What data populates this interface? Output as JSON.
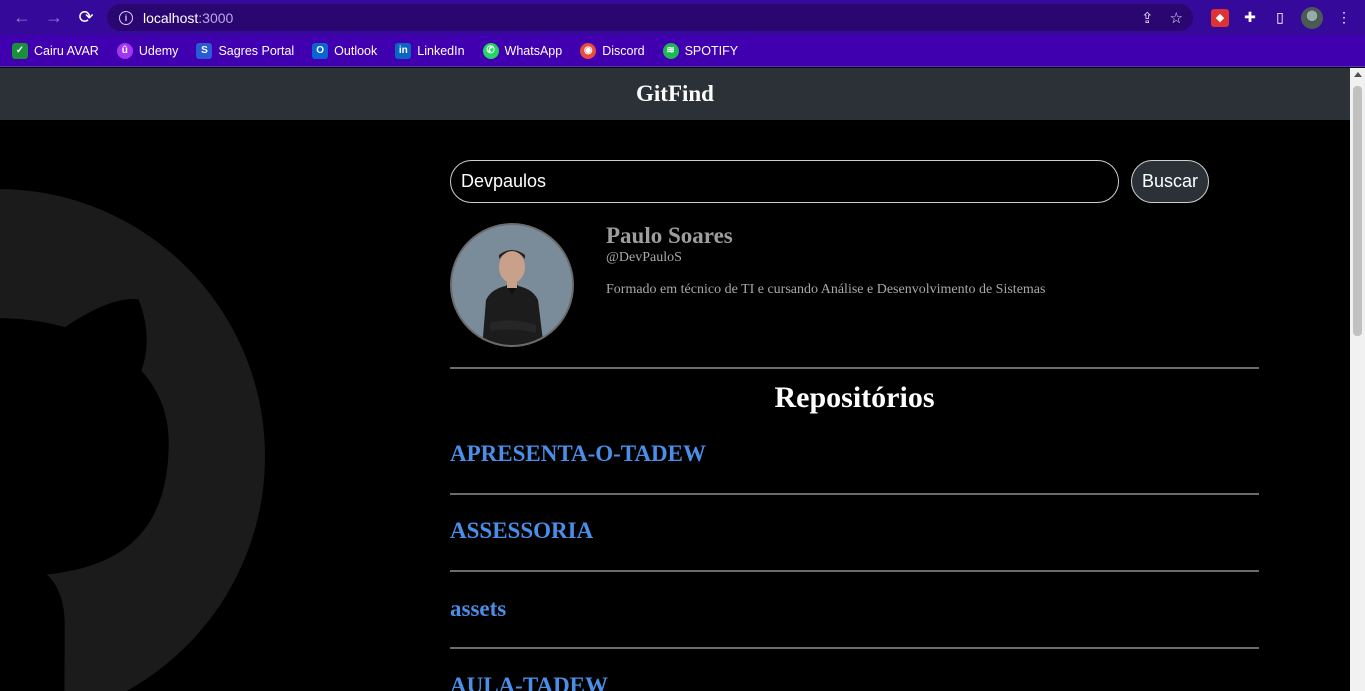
{
  "browser": {
    "url_host": "localhost",
    "url_port": ":3000",
    "bookmarks": [
      {
        "label": "Cairu AVAR",
        "icon": "cairu-icon",
        "color": "#1a8f3c"
      },
      {
        "label": "Udemy",
        "icon": "udemy-icon",
        "color": "#a435f0"
      },
      {
        "label": "Sagres Portal",
        "icon": "sagres-icon",
        "color": "#2a5bd7"
      },
      {
        "label": "Outlook",
        "icon": "outlook-icon",
        "color": "#0a64d1"
      },
      {
        "label": "LinkedIn",
        "icon": "linkedin-icon",
        "color": "#0a66c2"
      },
      {
        "label": "WhatsApp",
        "icon": "whatsapp-icon",
        "color": "#25d366"
      },
      {
        "label": "Discord",
        "icon": "discord-icon",
        "color": "#e74c3c"
      },
      {
        "label": "SPOTIFY",
        "icon": "spotify-icon",
        "color": "#1db954"
      }
    ]
  },
  "app": {
    "title": "GitFind",
    "search_value": "Devpaulos",
    "search_button": "Buscar"
  },
  "profile": {
    "name": "Paulo Soares",
    "handle": "@DevPauloS",
    "bio": "Formado em técnico de TI e cursando Análise e Desenvolvimento de Sistemas"
  },
  "repos": {
    "heading": "Repositórios",
    "items": [
      "APRESENTA-O-TADEW",
      "ASSESSORIA",
      "assets",
      "AULA-TADEW"
    ]
  },
  "colors": {
    "header_bg": "#2b3137",
    "repo_link": "#4a8ee8",
    "chrome_bg": "#350a9b"
  }
}
